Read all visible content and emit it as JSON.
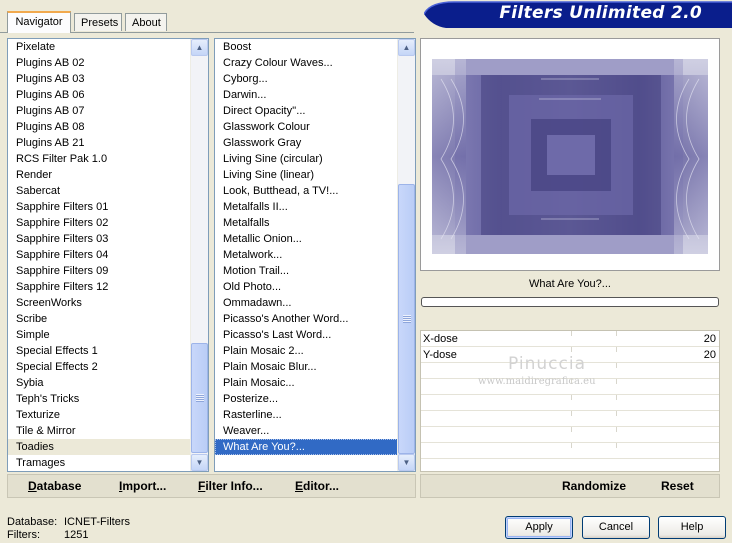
{
  "tabs": [
    {
      "label": "Navigator",
      "active": true
    },
    {
      "label": "Presets",
      "active": false
    },
    {
      "label": "About",
      "active": false
    }
  ],
  "banner": {
    "title": "Filters Unlimited 2.0",
    "color": "#0A1E8C"
  },
  "categories": {
    "items": [
      "Pixelate",
      "Plugins AB 02",
      "Plugins AB 03",
      "Plugins AB 06",
      "Plugins AB 07",
      "Plugins AB 08",
      "Plugins AB 21",
      "RCS Filter Pak 1.0",
      "Render",
      "Sabercat",
      "Sapphire Filters 01",
      "Sapphire Filters 02",
      "Sapphire Filters 03",
      "Sapphire Filters 04",
      "Sapphire Filters 09",
      "Sapphire Filters 12",
      "ScreenWorks",
      "Scribe",
      "Simple",
      "Special Effects 1",
      "Special Effects 2",
      "Sybia",
      "Teph's Tricks",
      "Texturize",
      "Tile & Mirror",
      "Toadies",
      "Tramages"
    ],
    "selected": "Toadies"
  },
  "filters": {
    "items": [
      "Boost",
      "Crazy Colour Waves...",
      "Cyborg...",
      "Darwin...",
      "Direct Opacity''...",
      "Glasswork Colour",
      "Glasswork Gray",
      "Living Sine (circular)",
      "Living Sine (linear)",
      "Look, Butthead, a TV!...",
      "Metalfalls II...",
      "Metalfalls",
      "Metallic Onion...",
      "Metalwork...",
      "Motion Trail...",
      "Old Photo...",
      "Ommadawn...",
      "Picasso's Another Word...",
      "Picasso's Last Word...",
      "Plain Mosaic 2...",
      "Plain Mosaic Blur...",
      "Plain Mosaic...",
      "Posterize...",
      "Rasterline...",
      "Weaver...",
      "What Are You?..."
    ],
    "selected": "What Are You?..."
  },
  "preview": {
    "filter_name": "What Are You?...",
    "progress_percent": 0
  },
  "params": [
    {
      "label": "X-dose",
      "value": "20"
    },
    {
      "label": "Y-dose",
      "value": "20"
    }
  ],
  "watermark": {
    "name": "Pinuccia",
    "site": "www.maidiregrafica.eu"
  },
  "toolbar_left": [
    {
      "name": "database-button",
      "text": "Database",
      "ul": "D"
    },
    {
      "name": "import-button",
      "text": "Import...",
      "ul": "I"
    },
    {
      "name": "filter-info-button",
      "text": "Filter Info...",
      "ul": "F"
    },
    {
      "name": "editor-button",
      "text": "Editor...",
      "ul": "E"
    }
  ],
  "toolbar_right": [
    {
      "name": "randomize-button",
      "text": "Randomize"
    },
    {
      "name": "reset-button",
      "text": "Reset"
    }
  ],
  "status": {
    "database_label": "Database:",
    "database_value": "ICNET-Filters",
    "filters_label": "Filters:",
    "filters_value": "1251"
  },
  "buttons": {
    "apply": "Apply",
    "cancel": "Cancel",
    "help": "Help"
  }
}
